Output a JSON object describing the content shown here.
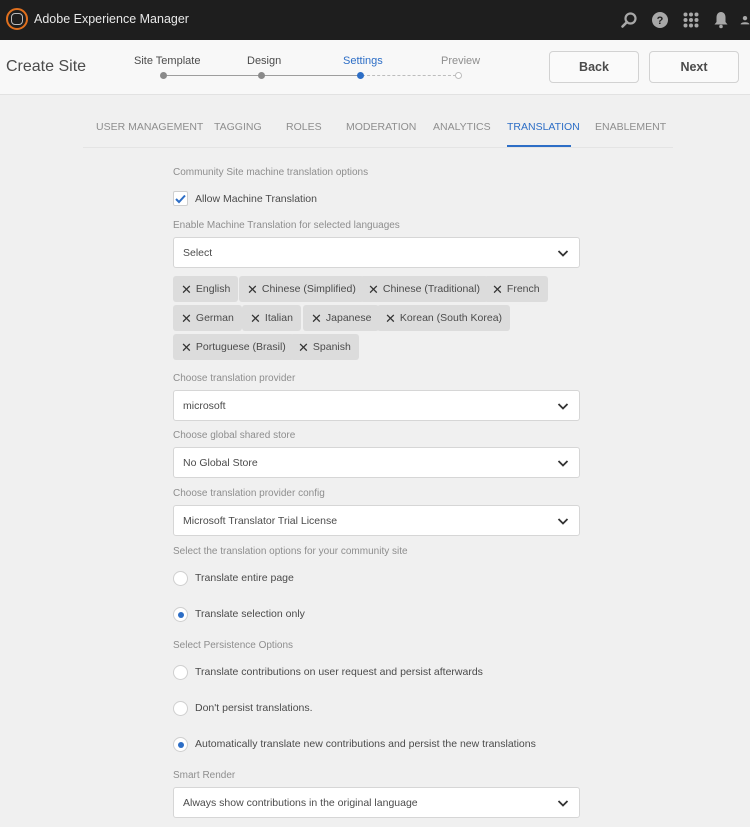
{
  "app": {
    "title": "Adobe Experience Manager",
    "icons": [
      "search-icon",
      "help-icon",
      "apps-grid-icon",
      "notification-bell-icon",
      "user-icon"
    ]
  },
  "header": {
    "page_title": "Create Site",
    "steps": [
      {
        "label": "Site Template",
        "state": "done"
      },
      {
        "label": "Design",
        "state": "done"
      },
      {
        "label": "Settings",
        "state": "active"
      },
      {
        "label": "Preview",
        "state": "future"
      }
    ],
    "back_label": "Back",
    "next_label": "Next"
  },
  "tabs": {
    "items": [
      "USER MANAGEMENT",
      "TAGGING",
      "ROLES",
      "MODERATION",
      "ANALYTICS",
      "TRANSLATION",
      "ENABLEMENT"
    ],
    "active": "TRANSLATION"
  },
  "colors": {
    "accent": "#2d6ec6",
    "topbar": "#1e1e1e",
    "logo": "#e0701e"
  },
  "form": {
    "section_label": "Community Site machine translation options",
    "allow_mt": {
      "label": "Allow Machine Translation",
      "checked": true
    },
    "languages_label": "Enable Machine Translation for selected languages",
    "languages_select": "Select",
    "languages": [
      "English",
      "Chinese (Simplified)",
      "Chinese (Traditional)",
      "French",
      "German",
      "Italian",
      "Japanese",
      "Korean (South Korea)",
      "Portuguese (Brasil)",
      "Spanish"
    ],
    "provider_label": "Choose translation provider",
    "provider_value": "microsoft",
    "store_label": "Choose global shared store",
    "store_value": "No Global Store",
    "config_label": "Choose translation provider config",
    "config_value": "Microsoft Translator Trial License",
    "options_label": "Select the translation options for your community site",
    "options": [
      {
        "label": "Translate entire page",
        "selected": false
      },
      {
        "label": "Translate selection only",
        "selected": true
      }
    ],
    "persistence_label": "Select Persistence Options",
    "persistence": [
      {
        "label": "Translate contributions on user request and persist afterwards",
        "selected": false
      },
      {
        "label": "Don't persist translations.",
        "selected": false
      },
      {
        "label": "Automatically translate new contributions and persist the new translations",
        "selected": true
      }
    ],
    "smart_render_label": "Smart Render",
    "smart_render_value": "Always show contributions in the original language"
  }
}
